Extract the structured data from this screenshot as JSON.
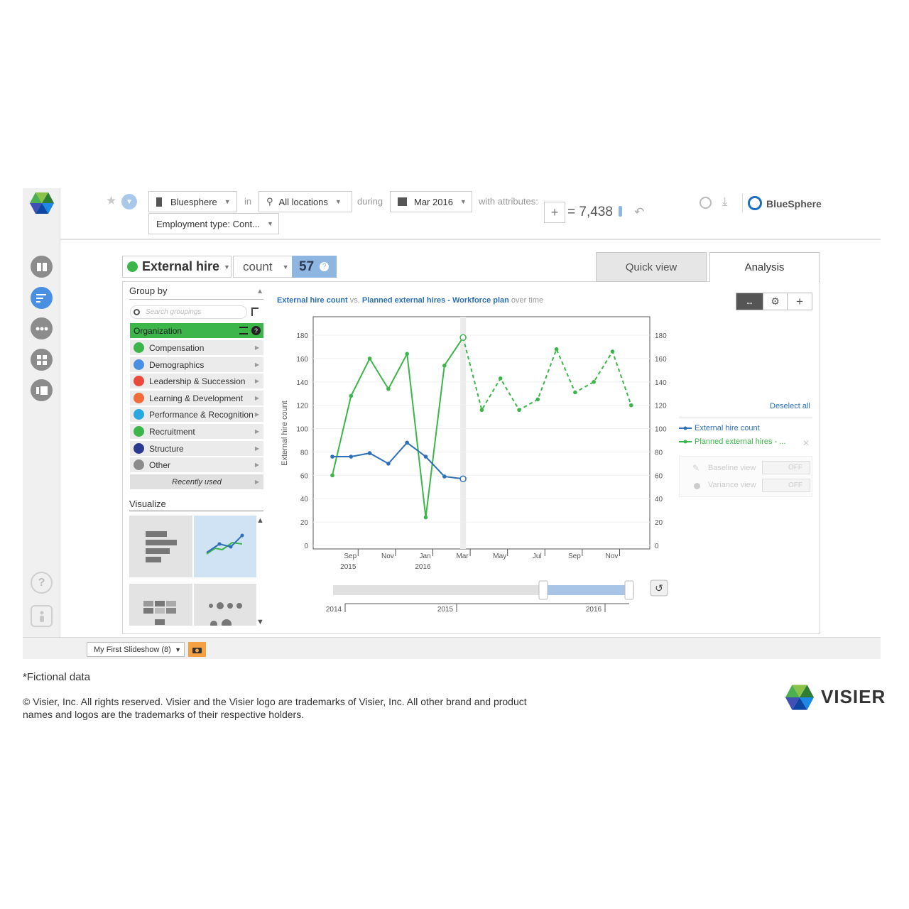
{
  "topbar": {
    "org": "Bluesphere",
    "in_label": "in",
    "location": "All locations",
    "during_label": "during",
    "period": "Mar 2016",
    "attributes_label": "with attributes:",
    "add_symbol": "+",
    "count_text": "= 7,438",
    "filter": "Employment type: Cont...",
    "brand": "BlueSphere"
  },
  "metric": {
    "name": "External hire",
    "measure": "count",
    "value": "57"
  },
  "tabs": {
    "quick": "Quick view",
    "analysis": "Analysis"
  },
  "group_by": {
    "title": "Group by",
    "search_placeholder": "Search groupings",
    "selected": "Organization",
    "items": [
      {
        "label": "Compensation",
        "color": "#3cb54a"
      },
      {
        "label": "Demographics",
        "color": "#4a90e2"
      },
      {
        "label": "Leadership & Succession",
        "color": "#e84b3c"
      },
      {
        "label": "Learning & Development",
        "color": "#f26b3a"
      },
      {
        "label": "Performance & Recognition",
        "color": "#29a8e0"
      },
      {
        "label": "Recruitment",
        "color": "#3cb54a"
      },
      {
        "label": "Structure",
        "color": "#2b3a8f"
      },
      {
        "label": "Other",
        "color": "#8c8c8c"
      }
    ],
    "recent": "Recently used"
  },
  "visualize": {
    "title": "Visualize"
  },
  "chart_title": {
    "a": "External hire count",
    "vs": "vs.",
    "b": "Planned external hires - Workforce plan",
    "rest": "over time"
  },
  "legend": {
    "deselect": "Deselect all",
    "s1": "External hire count",
    "s2": "Planned external hires - ...",
    "baseline": "Baseline view",
    "variance": "Variance view",
    "off": "OFF"
  },
  "slideshow": "My First Slideshow (8)",
  "footer": {
    "note": "*Fictional data",
    "copyright": "© Visier, Inc. All rights reserved. Visier and the Visier logo are trademarks of Visier, Inc. All other brand and product",
    "copyright2": "names and logos are the trademarks of their respective holders.",
    "logo_text": "VISIER"
  },
  "chart_data": {
    "type": "line",
    "ylabel": "External hire count",
    "ylim": [
      0,
      180
    ],
    "yticks": [
      0,
      20,
      40,
      60,
      80,
      100,
      120,
      140,
      160,
      180
    ],
    "x": [
      "Aug 2015",
      "Sep 2015",
      "Oct 2015",
      "Nov 2015",
      "Dec 2015",
      "Jan 2016",
      "Feb 2016",
      "Mar 2016",
      "Apr 2016",
      "May 2016",
      "Jun 2016",
      "Jul 2016",
      "Aug 2016",
      "Sep 2016",
      "Oct 2016",
      "Nov 2016",
      "Dec 2016"
    ],
    "xtick_labels": [
      {
        "label": "Sep",
        "sub": "2015",
        "i": 1
      },
      {
        "label": "Nov",
        "sub": "",
        "i": 3
      },
      {
        "label": "Jan",
        "sub": "2016",
        "i": 5
      },
      {
        "label": "Mar",
        "sub": "",
        "i": 7
      },
      {
        "label": "May",
        "sub": "",
        "i": 9
      },
      {
        "label": "Jul",
        "sub": "",
        "i": 11
      },
      {
        "label": "Sep",
        "sub": "",
        "i": 13
      },
      {
        "label": "Nov",
        "sub": "",
        "i": 15
      }
    ],
    "series": [
      {
        "name": "External hire count",
        "color": "#2e6fb7",
        "values": [
          76,
          76,
          79,
          70,
          88,
          76,
          59,
          57
        ]
      },
      {
        "name": "Planned external hires - Workforce plan",
        "color": "#3cb54a",
        "values": [
          60,
          128,
          160,
          134,
          164,
          24,
          154,
          178,
          116,
          143,
          116,
          125,
          168,
          131,
          140,
          166,
          120
        ]
      }
    ],
    "range_slider": {
      "labels": [
        "2014",
        "2015",
        "2016"
      ]
    }
  }
}
